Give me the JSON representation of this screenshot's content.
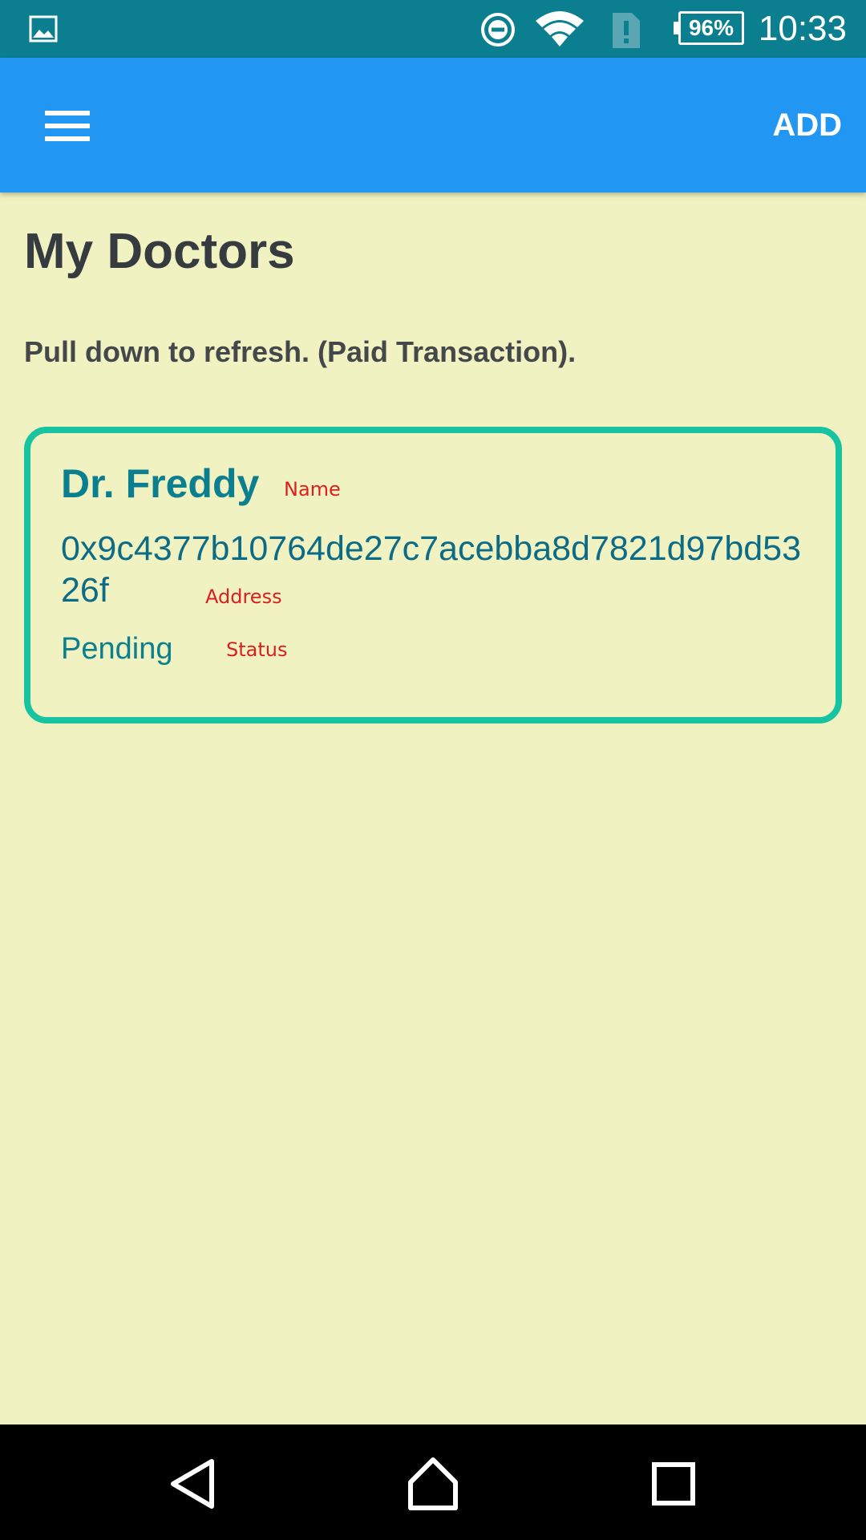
{
  "status_bar": {
    "time": "10:33",
    "battery": "96%",
    "icons": [
      "gallery-icon",
      "do-not-disturb-icon",
      "wifi-icon",
      "sim-alert-icon",
      "battery-icon"
    ]
  },
  "app_bar": {
    "menu_icon": "hamburger-menu-icon",
    "add_label": "ADD",
    "color": "#2296f3"
  },
  "page": {
    "title": "My Doctors",
    "hint": "Pull down to refresh. (Paid Transaction)."
  },
  "doctors": [
    {
      "name": "Dr. Freddy",
      "name_label": "Name",
      "address": "0x9c4377b10764de27c7acebba8d7821d97bd5326f",
      "address_label": "Address",
      "status": "Pending",
      "status_label": "Status"
    }
  ],
  "nav_bar": {
    "icons": [
      "back-icon",
      "home-icon",
      "recents-icon"
    ]
  },
  "colors": {
    "background": "#f0f3c1",
    "status_bar": "#0b7f8f",
    "card_border": "#17c3a0",
    "label": "#dd1e1e"
  }
}
